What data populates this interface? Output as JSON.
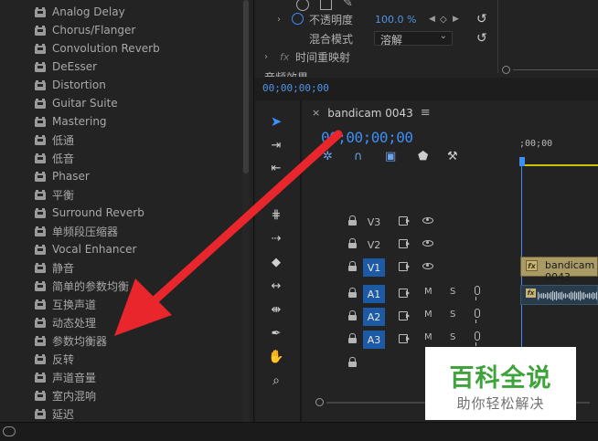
{
  "effects_panel": {
    "items": [
      "Analog Delay",
      "Chorus/Flanger",
      "Convolution Reverb",
      "DeEsser",
      "Distortion",
      "Guitar Suite",
      "Mastering",
      "低通",
      "低音",
      "Phaser",
      "平衡",
      "Surround Reverb",
      "单频段压缩器",
      "Vocal Enhancer",
      "静音",
      "简单的参数均衡",
      "互换声道",
      "动态处理",
      "参数均衡器",
      "反转",
      "声道音量",
      "室内混响",
      "延迟"
    ]
  },
  "effect_controls": {
    "opacity_label": "不透明度",
    "opacity_value": "100.0 %",
    "blend_label": "混合模式",
    "blend_value": "溶解",
    "time_remap_label": "时间重映射",
    "audio_effects_label": "音频效果",
    "fx_label": "fx",
    "current_time": "00;00;00;00"
  },
  "timeline": {
    "sequence_name": "bandicam 0043",
    "timecode": "00;00;00;00",
    "ruler_label": ";00;00",
    "video_tracks": [
      "V3",
      "V2",
      "V1"
    ],
    "audio_tracks": [
      "A1",
      "A2",
      "A3"
    ],
    "active_video": "V1",
    "mute_label": "M",
    "solo_label": "S",
    "video_clip_label": "bandicam 0043",
    "fx_badge": "fx"
  },
  "watermark": {
    "title": "百科全说",
    "subtitle": "助你轻松解决"
  },
  "colors": {
    "accent_blue": "#3d8ef5",
    "active_track": "#1d5aa6",
    "video_clip": "#a99a66",
    "audio_clip": "#283c4c",
    "arrow_red": "#e8262b",
    "watermark_green": "#3fa33c"
  }
}
